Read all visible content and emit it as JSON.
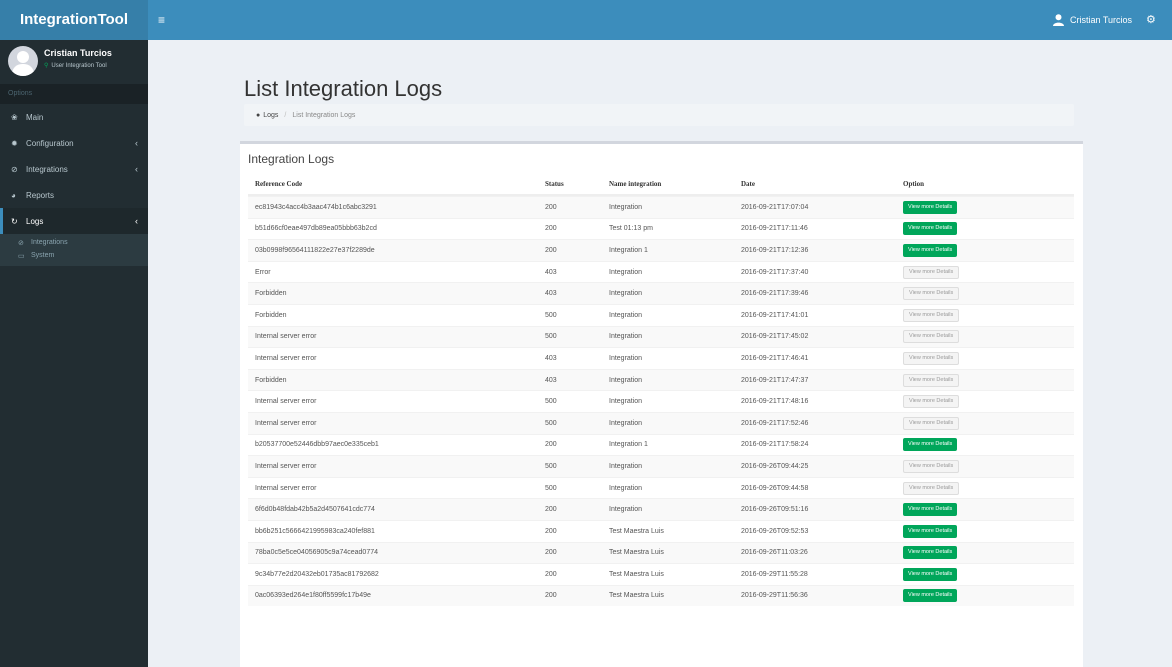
{
  "app": {
    "title": "IntegrationTool",
    "menu_toggle": "≡"
  },
  "header": {
    "user_name": "Cristian Turcios",
    "settings_icon": "gears-icon"
  },
  "sidebar": {
    "user_name": "Cristian Turcios",
    "user_role": "User Integration Tool",
    "section_label": "Options",
    "items": [
      {
        "label": "Main",
        "icon": "dashboard-icon",
        "glyph": "❀"
      },
      {
        "label": "Configuration",
        "icon": "gear-icon",
        "glyph": "✹",
        "chevron": "‹"
      },
      {
        "label": "Integrations",
        "icon": "link-icon",
        "glyph": "⊘",
        "chevron": "‹"
      },
      {
        "label": "Reports",
        "icon": "pie-chart-icon",
        "glyph": "◕"
      },
      {
        "label": "Logs",
        "icon": "history-icon",
        "glyph": "↻",
        "chevron": "‹"
      }
    ],
    "sub_items": [
      {
        "label": "Integrations",
        "icon": "link-icon",
        "glyph": "⊘"
      },
      {
        "label": "System",
        "icon": "monitor-icon",
        "glyph": "▭"
      }
    ]
  },
  "page": {
    "title": "List Integration Logs",
    "breadcrumb": {
      "home": "Logs",
      "separator": "/",
      "current": "List Integration Logs"
    }
  },
  "table": {
    "box_title": "Integration Logs",
    "headers": {
      "ref": "Reference Code",
      "status": "Status",
      "name": "Name integration",
      "date": "Date",
      "option": "Option"
    },
    "rows": [
      {
        "ref": "ec81943c4acc4b3aac474b1c6abc3291",
        "status": "200",
        "name": "Integration",
        "date": "2016-09-21T17:07:04",
        "btn": "View more Details",
        "variant": "success"
      },
      {
        "ref": "b51d66cf0eae497db89ea05bbb63b2cd",
        "status": "200",
        "name": "Test 01:13 pm",
        "date": "2016-09-21T17:11:46",
        "btn": "View more Details",
        "variant": "success"
      },
      {
        "ref": "03b0998f96564111822e27e37f2289de",
        "status": "200",
        "name": "Integration 1",
        "date": "2016-09-21T17:12:36",
        "btn": "View more Details",
        "variant": "success"
      },
      {
        "ref": "Error",
        "status": "403",
        "name": "Integration",
        "date": "2016-09-21T17:37:40",
        "btn": "View more Details",
        "variant": "default"
      },
      {
        "ref": "Forbidden",
        "status": "403",
        "name": "Integration",
        "date": "2016-09-21T17:39:46",
        "btn": "View more Details",
        "variant": "default"
      },
      {
        "ref": "Forbidden",
        "status": "500",
        "name": "Integration",
        "date": "2016-09-21T17:41:01",
        "btn": "View more Details",
        "variant": "default"
      },
      {
        "ref": "Internal server error",
        "status": "500",
        "name": "Integration",
        "date": "2016-09-21T17:45:02",
        "btn": "View more Details",
        "variant": "default"
      },
      {
        "ref": "Internal server error",
        "status": "403",
        "name": "Integration",
        "date": "2016-09-21T17:46:41",
        "btn": "View more Details",
        "variant": "default"
      },
      {
        "ref": "Forbidden",
        "status": "403",
        "name": "Integration",
        "date": "2016-09-21T17:47:37",
        "btn": "View more Details",
        "variant": "default"
      },
      {
        "ref": "Internal server error",
        "status": "500",
        "name": "Integration",
        "date": "2016-09-21T17:48:16",
        "btn": "View more Details",
        "variant": "default"
      },
      {
        "ref": "Internal server error",
        "status": "500",
        "name": "Integration",
        "date": "2016-09-21T17:52:46",
        "btn": "View more Details",
        "variant": "default"
      },
      {
        "ref": "b20537700e52446dbb97aec0e335ceb1",
        "status": "200",
        "name": "Integration 1",
        "date": "2016-09-21T17:58:24",
        "btn": "View more Details",
        "variant": "success"
      },
      {
        "ref": "Internal server error",
        "status": "500",
        "name": "Integration",
        "date": "2016-09-26T09:44:25",
        "btn": "View more Details",
        "variant": "default"
      },
      {
        "ref": "Internal server error",
        "status": "500",
        "name": "Integration",
        "date": "2016-09-26T09:44:58",
        "btn": "View more Details",
        "variant": "default"
      },
      {
        "ref": "6f6d0b48fdab42b5a2d4507641cdc774",
        "status": "200",
        "name": "Integration",
        "date": "2016-09-26T09:51:16",
        "btn": "View more Details",
        "variant": "success"
      },
      {
        "ref": "bb6b251c5666421995983ca240fef881",
        "status": "200",
        "name": "Test Maestra Luis",
        "date": "2016-09-26T09:52:53",
        "btn": "View more Details",
        "variant": "success"
      },
      {
        "ref": "78ba0c5e5ce04056905c9a74cead0774",
        "status": "200",
        "name": "Test Maestra Luis",
        "date": "2016-09-26T11:03:26",
        "btn": "View more Details",
        "variant": "success"
      },
      {
        "ref": "9c34b77e2d20432eb01735ac81792682",
        "status": "200",
        "name": "Test Maestra Luis",
        "date": "2016-09-29T11:55:28",
        "btn": "View more Details",
        "variant": "success"
      },
      {
        "ref": "0ac06393ed264e1f80ff5599fc17b49e",
        "status": "200",
        "name": "Test Maestra Luis",
        "date": "2016-09-29T11:56:36",
        "btn": "View more Details",
        "variant": "success"
      }
    ]
  },
  "colors": {
    "header": "#3c8dbc",
    "logo_bg": "#367fa9",
    "sidebar": "#222d32",
    "success": "#00a65a",
    "content_bg": "#ecf0f5"
  }
}
